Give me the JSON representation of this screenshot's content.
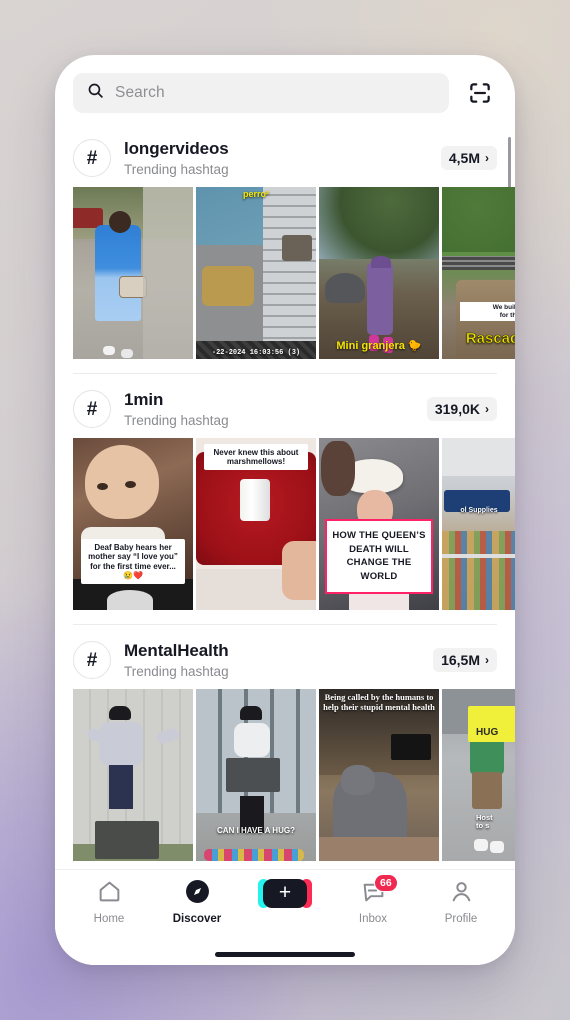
{
  "search": {
    "placeholder": "Search",
    "value": "",
    "icon": "search-icon",
    "scan_icon": "scan-qr-icon"
  },
  "sections": [
    {
      "hash_symbol": "#",
      "name": "longervideos",
      "subtitle": "Trending hashtag",
      "count": "4,5M",
      "chevron": "›",
      "thumbs": [
        {
          "caption": "",
          "style": "none",
          "pos": ""
        },
        {
          "caption": "perro²",
          "style": "cap-yellow",
          "pos": "top",
          "caption2": "-22-2024  16:03:56  (3)"
        },
        {
          "caption": "Mini granjera 🐤",
          "style": "cap-yellow",
          "pos": "bottom"
        },
        {
          "caption": "Rascador",
          "style": "cap-yellow-big",
          "pos": "bottom",
          "caption2": "We built a\nfor th"
        }
      ]
    },
    {
      "hash_symbol": "#",
      "name": "1min",
      "subtitle": "Trending hashtag",
      "count": "319,0K",
      "chevron": "›",
      "thumbs": [
        {
          "caption": "Deaf Baby hears her mother say “I love you” for the first time ever...😢❤️",
          "style": "cap-white-box",
          "pos": "lower"
        },
        {
          "caption": "Never knew this about marshmellows!",
          "style": "cap-white-box",
          "pos": "top"
        },
        {
          "caption": "HOW THE QUEEN’S DEATH WILL CHANGE THE WORLD",
          "style": "cap-queen",
          "pos": "lower"
        },
        {
          "caption": "ol Supplies",
          "style": "cap-white-shadow",
          "pos": "mid"
        }
      ]
    },
    {
      "hash_symbol": "#",
      "name": "MentalHealth",
      "subtitle": "Trending hashtag",
      "count": "16,5M",
      "chevron": "›",
      "thumbs": [
        {
          "caption": "",
          "style": "none",
          "pos": ""
        },
        {
          "caption": "CAN I HAVE A HUG?",
          "style": "cap-white-shadow",
          "pos": "lower"
        },
        {
          "caption": "Being called by the humans to help their stupid mental health",
          "style": "cap-serif",
          "pos": "top"
        },
        {
          "caption": "HUG",
          "style": "cap-yellow",
          "pos": "top",
          "caption2": "Host\nto s"
        }
      ]
    }
  ],
  "nav": {
    "items": [
      {
        "label": "Home",
        "icon": "home-icon",
        "active": false
      },
      {
        "label": "Discover",
        "icon": "compass-icon",
        "active": true
      },
      {
        "label": "",
        "icon": "plus-icon",
        "active": false
      },
      {
        "label": "Inbox",
        "icon": "inbox-icon",
        "active": false,
        "badge": "66"
      },
      {
        "label": "Profile",
        "icon": "person-icon",
        "active": false
      }
    ]
  },
  "colors": {
    "accent_cyan": "#25f4ee",
    "accent_pink": "#fe2c55",
    "badge_red": "#ef2950",
    "text_primary": "#161823",
    "text_secondary": "#8a8b90"
  }
}
